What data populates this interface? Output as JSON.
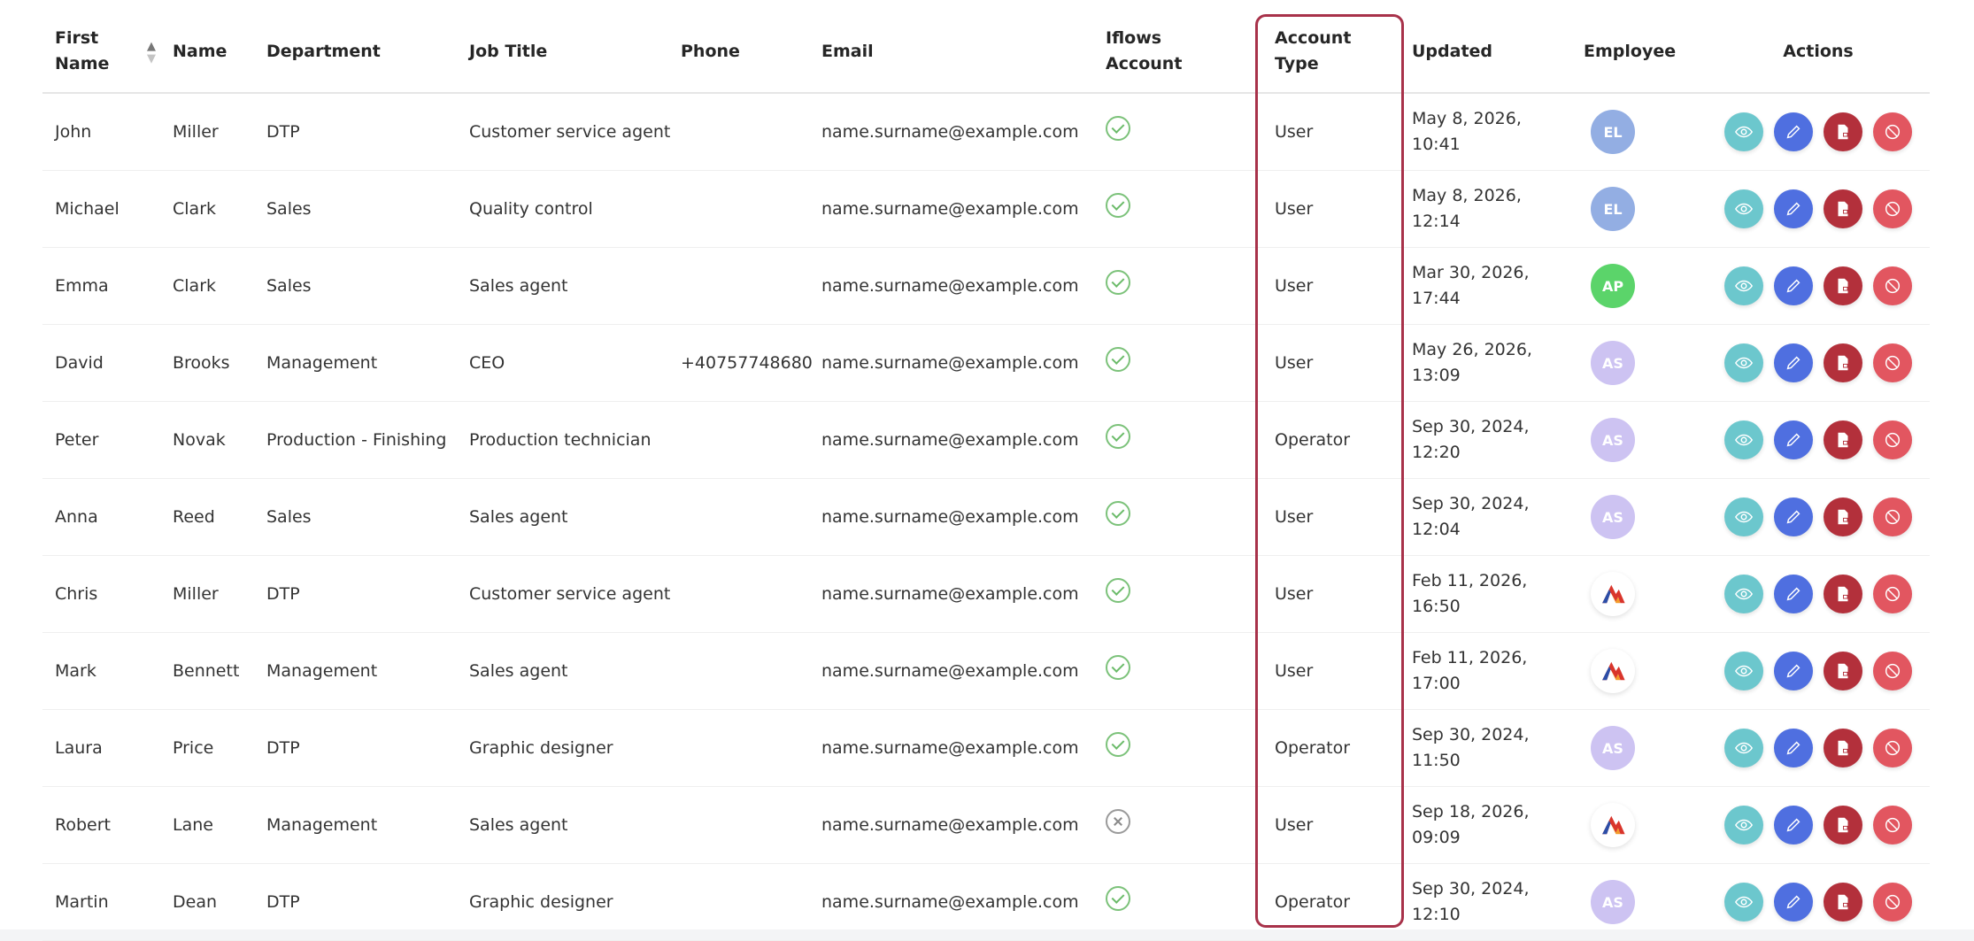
{
  "table": {
    "headers": {
      "first_name": [
        "First",
        "Name"
      ],
      "name": "Name",
      "department": "Department",
      "job_title": "Job Title",
      "phone": "Phone",
      "email": "Email",
      "iflows_account": [
        "Iflows",
        "Account"
      ],
      "account_type": [
        "Account",
        "Type"
      ],
      "updated": "Updated",
      "employee": "Employee",
      "actions": "Actions"
    },
    "sort_icon": "sort-up-down-icon",
    "rows": [
      {
        "first_name": "John",
        "name": "Miller",
        "department": "DTP",
        "job_title": "Customer service agent",
        "phone": "",
        "email": "name.surname@example.com",
        "iflows_account": "check",
        "account_type": "User",
        "updated": "May 8, 2026, 10:41",
        "employee": {
          "type": "initials",
          "text": "EL",
          "color": "#93aee3"
        }
      },
      {
        "first_name": "Michael",
        "name": "Clark",
        "department": "Sales",
        "job_title": "Quality control",
        "phone": "",
        "email": "name.surname@example.com",
        "iflows_account": "check",
        "account_type": "User",
        "updated": "May 8, 2026, 12:14",
        "employee": {
          "type": "initials",
          "text": "EL",
          "color": "#93aee3"
        }
      },
      {
        "first_name": "Emma",
        "name": "Clark",
        "department": "Sales",
        "job_title": "Sales agent",
        "phone": "",
        "email": "name.surname@example.com",
        "iflows_account": "check",
        "account_type": "User",
        "updated": "Mar 30, 2026, 17:44",
        "employee": {
          "type": "initials",
          "text": "AP",
          "color": "#5bd46a"
        }
      },
      {
        "first_name": "David",
        "name": "Brooks",
        "department": "Management",
        "job_title": "CEO",
        "phone": "+40757748680",
        "email": "name.surname@example.com",
        "iflows_account": "check",
        "account_type": "User",
        "updated": "May 26, 2026, 13:09",
        "employee": {
          "type": "initials",
          "text": "AS",
          "color": "#cdc3f2"
        }
      },
      {
        "first_name": "Peter",
        "name": "Novak",
        "department": "Production - Finishing",
        "job_title": "Production technician",
        "phone": "",
        "email": "name.surname@example.com",
        "iflows_account": "check",
        "account_type": "Operator",
        "updated": "Sep 30, 2024, 12:20",
        "employee": {
          "type": "initials",
          "text": "AS",
          "color": "#cdc3f2"
        }
      },
      {
        "first_name": "Anna",
        "name": "Reed",
        "department": "Sales",
        "job_title": "Sales agent",
        "phone": "",
        "email": "name.surname@example.com",
        "iflows_account": "check",
        "account_type": "User",
        "updated": "Sep 30, 2024, 12:04",
        "employee": {
          "type": "initials",
          "text": "AS",
          "color": "#cdc3f2"
        }
      },
      {
        "first_name": "Chris",
        "name": "Miller",
        "department": "DTP",
        "job_title": "Customer service agent",
        "phone": "",
        "email": "name.surname@example.com",
        "iflows_account": "check",
        "account_type": "User",
        "updated": "Feb 11, 2026, 16:50",
        "employee": {
          "type": "logo",
          "icon": "company-logo-icon"
        }
      },
      {
        "first_name": "Mark",
        "name": "Bennett",
        "department": "Management",
        "job_title": "Sales agent",
        "phone": "",
        "email": "name.surname@example.com",
        "iflows_account": "check",
        "account_type": "User",
        "updated": "Feb 11, 2026, 17:00",
        "employee": {
          "type": "logo",
          "icon": "company-logo-icon"
        }
      },
      {
        "first_name": "Laura",
        "name": "Price",
        "department": "DTP",
        "job_title": "Graphic designer",
        "phone": "",
        "email": "name.surname@example.com",
        "iflows_account": "check",
        "account_type": "Operator",
        "updated": "Sep 30, 2024, 11:50",
        "employee": {
          "type": "initials",
          "text": "AS",
          "color": "#cdc3f2"
        }
      },
      {
        "first_name": "Robert",
        "name": "Lane",
        "department": "Management",
        "job_title": "Sales agent",
        "phone": "",
        "email": "name.surname@example.com",
        "iflows_account": "cross",
        "account_type": "User",
        "updated": "Sep 18, 2026, 09:09",
        "employee": {
          "type": "logo",
          "icon": "company-logo-icon"
        }
      },
      {
        "first_name": "Martin",
        "name": "Dean",
        "department": "DTP",
        "job_title": "Graphic designer",
        "phone": "",
        "email": "name.surname@example.com",
        "iflows_account": "check",
        "account_type": "Operator",
        "updated": "Sep 30, 2024, 12:10",
        "employee": {
          "type": "initials",
          "text": "AS",
          "color": "#cdc3f2"
        }
      }
    ],
    "actions": [
      {
        "name": "view",
        "icon": "eye-icon",
        "color": "#6cc7cd"
      },
      {
        "name": "edit",
        "icon": "pencil-icon",
        "color": "#4f6fe0"
      },
      {
        "name": "document",
        "icon": "document-icon",
        "color": "#b3303b"
      },
      {
        "name": "disable",
        "icon": "block-icon",
        "color": "#e25660"
      }
    ]
  },
  "colors": {
    "highlight_border": "#a8324a",
    "check": "#6bbb69"
  }
}
